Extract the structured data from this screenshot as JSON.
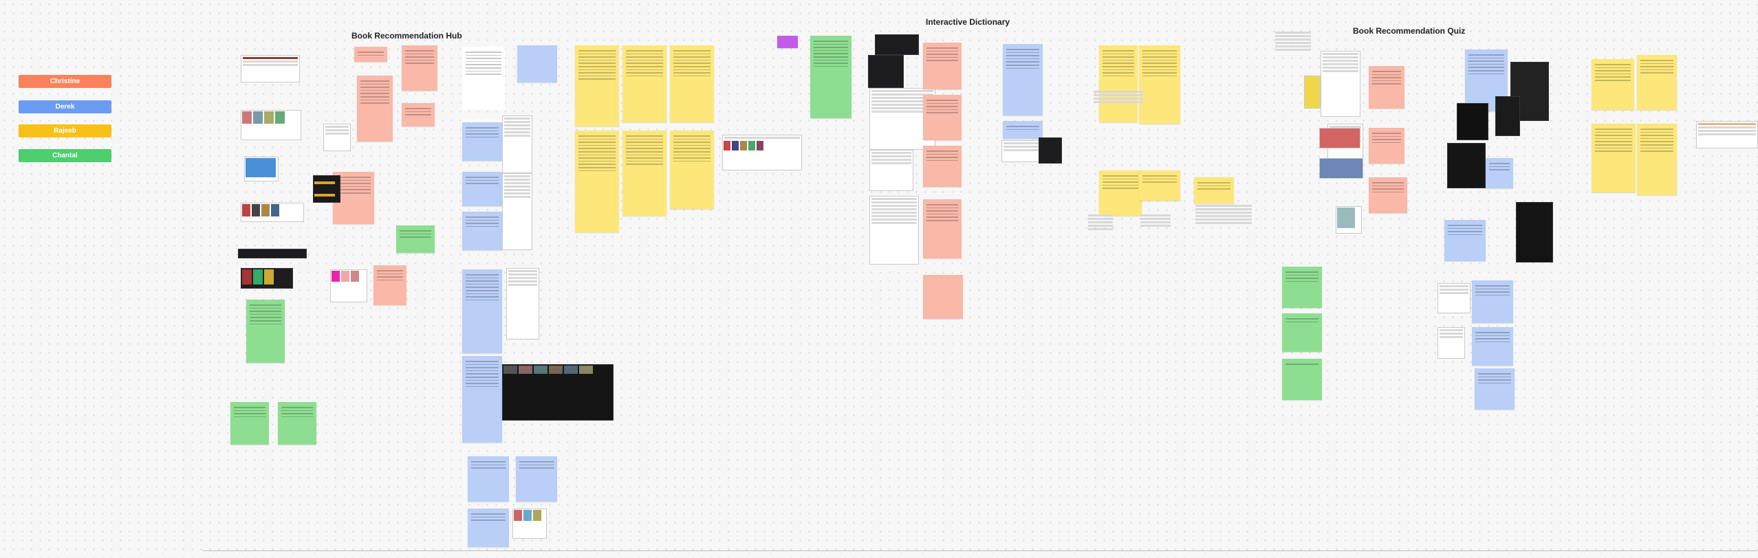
{
  "legend": [
    {
      "name": "Christine",
      "color": "#f9825a"
    },
    {
      "name": "Derek",
      "color": "#6c9cf2"
    },
    {
      "name": "Rajeeb",
      "color": "#f8c117"
    },
    {
      "name": "Chantal",
      "color": "#4ccf6c"
    }
  ],
  "sections": {
    "hub": "Book Recommendation Hub",
    "dictionary": "Interactive Dictionary",
    "quiz": "Book Recommendation Quiz"
  },
  "colors": {
    "yellow": "#fde77a",
    "blue": "#b9cff8",
    "pink": "#f9b8a8",
    "green": "#8ede92",
    "canvas": "#f7f7f7"
  }
}
